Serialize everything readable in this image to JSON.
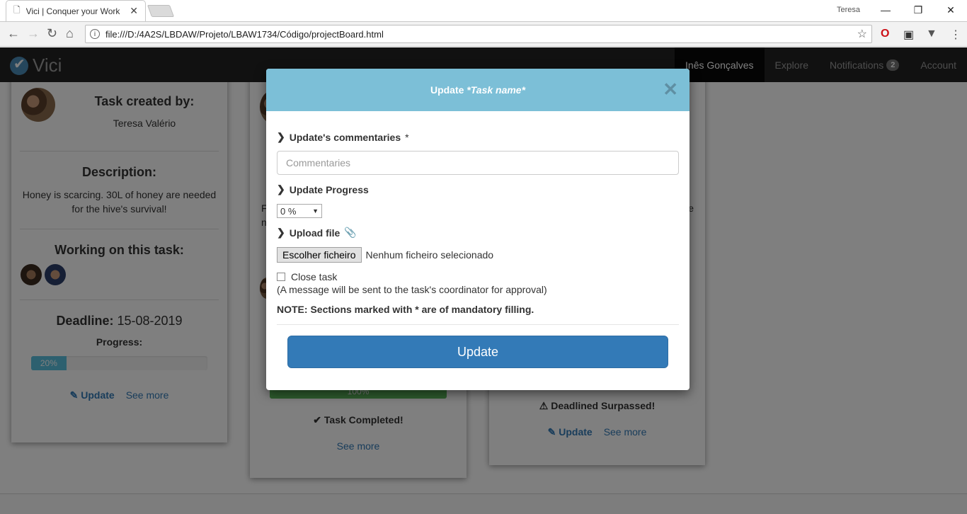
{
  "browser": {
    "tab_title": "Vici | Conquer your Work",
    "profile_name": "Teresa",
    "url": "file:///D:/4A2S/LBDAW/Projeto/LBAW1734/Código/projectBoard.html"
  },
  "navbar": {
    "brand": "Vici",
    "links": [
      "Inês Gonçalves",
      "Explore",
      "Notifications",
      "Account"
    ],
    "notifications_count": "2"
  },
  "card1": {
    "created_by_title": "Task created by:",
    "creator": "Teresa Valério",
    "description_title": "Description:",
    "description": "Honey is scarcing. 30L of honey are needed for the hive's survival!",
    "working_title": "Working on this task:",
    "deadline_label": "Deadline:",
    "deadline": "15-08-2019",
    "progress_label": "Progress:",
    "progress_text": "20%",
    "progress_fraction": 0.2,
    "update": "Update",
    "see_more": "See more"
  },
  "card2": {
    "partial_left": "F",
    "partial_left2": "n",
    "progress_text": "100%",
    "status": "Task Completed!",
    "see_more": "See more"
  },
  "card3": {
    "partial_right": "e",
    "status": "Deadlined Surpassed!",
    "update": "Update",
    "see_more": "See more"
  },
  "modal": {
    "title_prefix": "Update ",
    "title_em": "*Task name*",
    "commentaries_label": "Update's commentaries",
    "required_mark": "*",
    "commentaries_placeholder": "Commentaries",
    "progress_label": "Update Progress",
    "progress_value": "0 %",
    "upload_label": "Upload file",
    "choose_file": "Escolher ficheiro",
    "no_file": "Nenhum ficheiro selecionado",
    "close_task": "Close task",
    "close_note": "(A message will be sent to the task's coordinator for approval)",
    "note": "NOTE: Sections marked with * are of mandatory filling.",
    "submit": "Update"
  }
}
